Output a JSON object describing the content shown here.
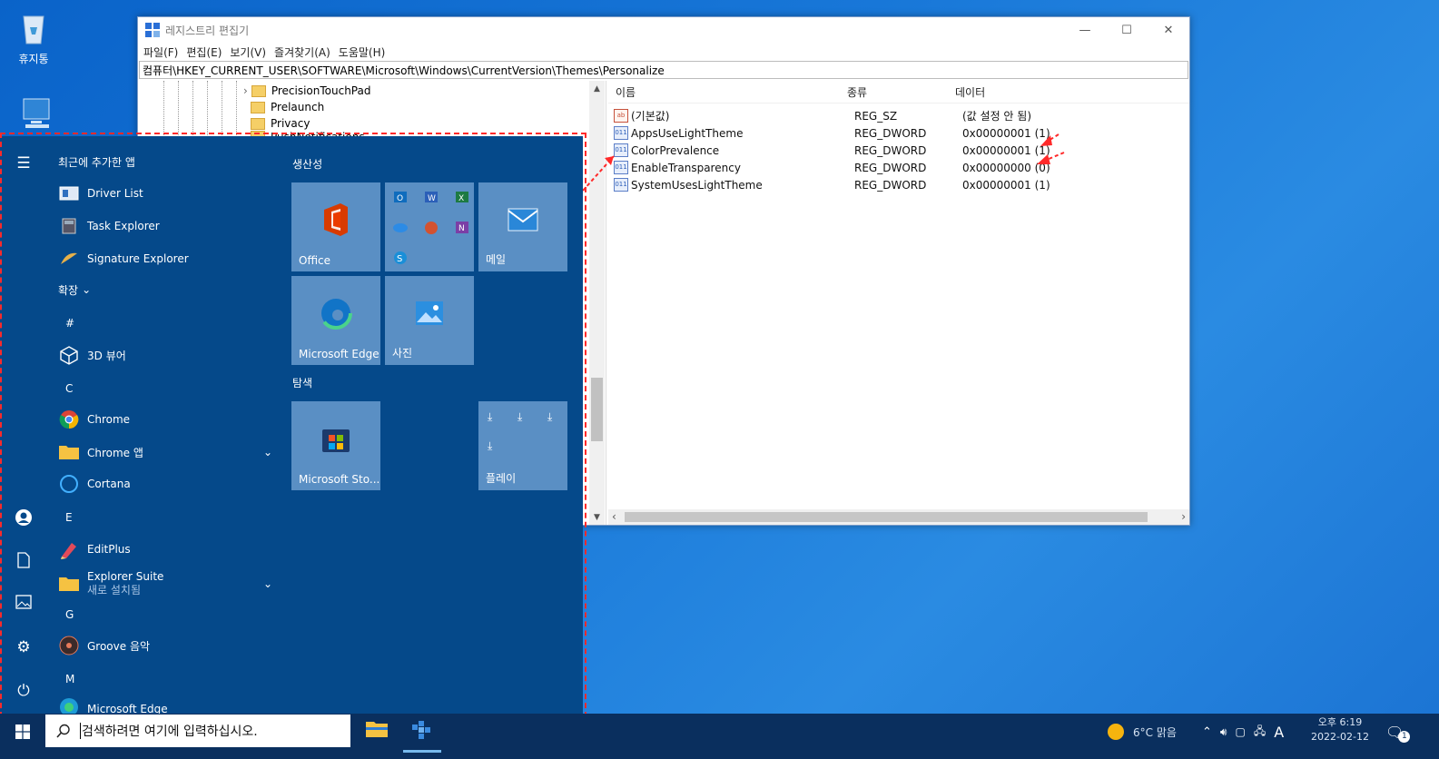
{
  "desktop": {
    "recycle_bin": "휴지통"
  },
  "regedit": {
    "title": "레지스트리 편집기",
    "menu": [
      "파일(F)",
      "편집(E)",
      "보기(V)",
      "즐겨찾기(A)",
      "도움말(H)"
    ],
    "address": "컴퓨터\\HKEY_CURRENT_USER\\SOFTWARE\\Microsoft\\Windows\\CurrentVersion\\Themes\\Personalize",
    "tree": [
      "PrecisionTouchPad",
      "Prelaunch",
      "Privacy",
      "PushNotifications"
    ],
    "columns": {
      "name": "이름",
      "type": "종류",
      "data": "데이터"
    },
    "rows": [
      {
        "name": "(기본값)",
        "type": "REG_SZ",
        "data": "(값 설정 안 됨)"
      },
      {
        "name": "AppsUseLightTheme",
        "type": "REG_DWORD",
        "data": "0x00000001 (1)"
      },
      {
        "name": "ColorPrevalence",
        "type": "REG_DWORD",
        "data": "0x00000001 (1)"
      },
      {
        "name": "EnableTransparency",
        "type": "REG_DWORD",
        "data": "0x00000000 (0)"
      },
      {
        "name": "SystemUsesLightTheme",
        "type": "REG_DWORD",
        "data": "0x00000001 (1)"
      }
    ]
  },
  "start_menu": {
    "recent_header": "최근에 추가한 앱",
    "recent": [
      "Driver List",
      "Task Explorer",
      "Signature Explorer"
    ],
    "expand": "확장",
    "letters": {
      "hash": "#",
      "c": "C",
      "e": "E",
      "g": "G",
      "m": "M"
    },
    "apps": {
      "viewer3d": "3D 뷰어",
      "chrome": "Chrome",
      "chrome_apps": "Chrome 앱",
      "cortana": "Cortana",
      "editplus": "EditPlus",
      "explorer_suite": "Explorer Suite",
      "explorer_suite_sub": "새로 설치됨",
      "groove": "Groove 음악",
      "edge": "Microsoft Edge"
    },
    "groups": {
      "productivity": "생산성",
      "explore": "탐색"
    },
    "tiles": {
      "office": "Office",
      "mail": "메일",
      "edge": "Microsoft Edge",
      "photos": "사진",
      "store": "Microsoft Sto...",
      "play": "플레이"
    }
  },
  "taskbar": {
    "search_placeholder": "검색하려면 여기에 입력하십시오.",
    "weather": "6°C 맑음",
    "ime": "A",
    "time": "오후 6:19",
    "date": "2022-02-12",
    "notification_count": "1"
  },
  "colors": {
    "accent_red": "#ff2a2a",
    "start_bg": "#05498a",
    "tile_bg": "#5a8fc4"
  }
}
